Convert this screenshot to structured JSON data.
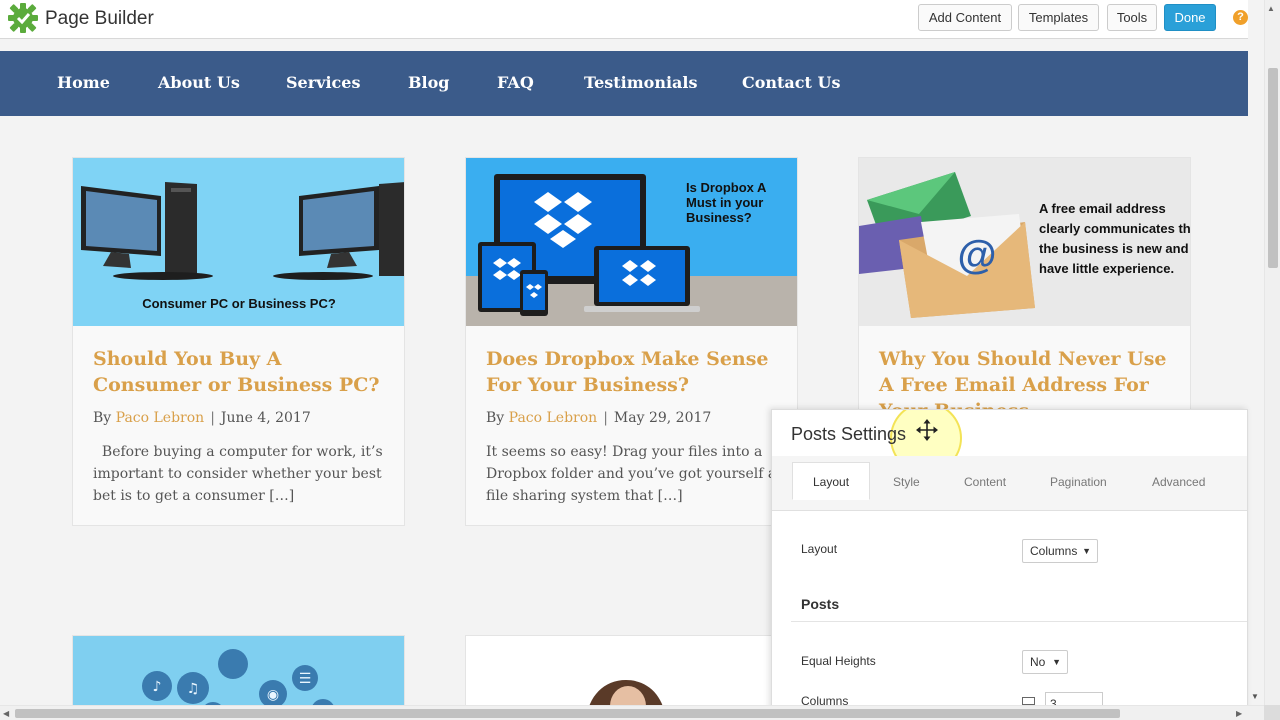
{
  "builder": {
    "title": "Page Builder",
    "buttons": {
      "add_content": "Add Content",
      "templates": "Templates",
      "tools": "Tools",
      "done": "Done"
    },
    "help_icon": "?"
  },
  "nav": {
    "items": [
      "Home",
      "About Us",
      "Services",
      "Blog",
      "FAQ",
      "Testimonials",
      "Contact Us"
    ]
  },
  "posts": [
    {
      "title": "Should You Buy A Consumer or Business PC?",
      "by": "By",
      "author": "Paco Lebron",
      "date": "June 4, 2017",
      "excerpt": "  Before buying a computer for work, it’s important to consider whether your best bet is to get a consumer […]",
      "image_caption": "Consumer PC or Business PC?"
    },
    {
      "title": "Does Dropbox Make Sense For Your Business?",
      "by": "By",
      "author": "Paco Lebron",
      "date": "May 29, 2017",
      "excerpt": "It seems so easy! Drag your files into a Dropbox folder and you’ve got yourself a file sharing system that […]",
      "image_caption": "Is Dropbox A Must in your Business?"
    },
    {
      "title": "Why You Should Never Use A Free Email Address For Your Business",
      "image_caption": "A free email address clearly communicates that the business is new and have little experience."
    }
  ],
  "panel": {
    "title": "Posts Settings",
    "tabs": [
      "Layout",
      "Style",
      "Content",
      "Pagination",
      "Advanced"
    ],
    "active_tab": "Layout",
    "layout_label": "Layout",
    "layout_value": "Columns",
    "section_posts": "Posts",
    "equal_heights_label": "Equal Heights",
    "equal_heights_value": "No",
    "columns_label": "Columns",
    "columns_value": "3"
  },
  "colors": {
    "nav_bg": "#3b5b8a",
    "accent": "#d9a04a",
    "done_button": "#2aa0d8",
    "logo_green": "#4caf50"
  },
  "icons": {
    "logo": "gear-logo-icon",
    "move": "move-arrows-icon",
    "help": "question-circle-icon",
    "responsive": "monitor-icon"
  }
}
